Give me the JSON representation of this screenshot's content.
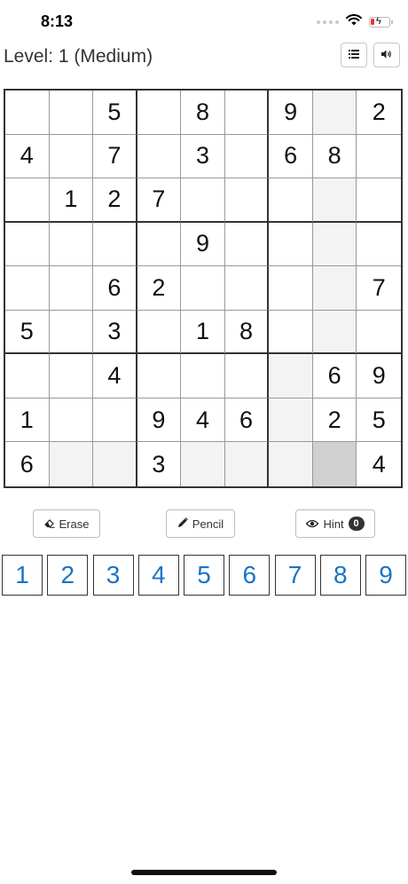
{
  "status_bar": {
    "time": "8:13"
  },
  "header": {
    "level_text": "Level: 1 (Medium)",
    "menu_icon": "list-icon",
    "sound_icon": "speaker-icon"
  },
  "board": {
    "rows": [
      [
        "",
        "",
        "5",
        "",
        "8",
        "",
        "9",
        "",
        "2"
      ],
      [
        "4",
        "",
        "7",
        "",
        "3",
        "",
        "6",
        "8",
        ""
      ],
      [
        "",
        "1",
        "2",
        "7",
        "",
        "",
        "",
        "",
        ""
      ],
      [
        "",
        "",
        "",
        "",
        "9",
        "",
        "",
        "",
        ""
      ],
      [
        "",
        "",
        "6",
        "2",
        "",
        "",
        "",
        "",
        "7"
      ],
      [
        "5",
        "",
        "3",
        "",
        "1",
        "8",
        "",
        "",
        ""
      ],
      [
        "",
        "",
        "4",
        "",
        "",
        "",
        "",
        "6",
        "9"
      ],
      [
        "1",
        "",
        "",
        "9",
        "4",
        "6",
        "",
        "2",
        "5"
      ],
      [
        "6",
        "",
        "",
        "3",
        "",
        "",
        "",
        "",
        "4"
      ]
    ],
    "selected_cell": {
      "row": 8,
      "col": 7
    },
    "highlight_color": "#f3f3f3",
    "selected_color": "#d0d0d0"
  },
  "tools": {
    "erase_label": "Erase",
    "pencil_label": "Pencil",
    "hint_label": "Hint",
    "hint_count": "0"
  },
  "numpad": {
    "keys": [
      "1",
      "2",
      "3",
      "4",
      "5",
      "6",
      "7",
      "8",
      "9"
    ],
    "key_color": "#1a73c7"
  }
}
